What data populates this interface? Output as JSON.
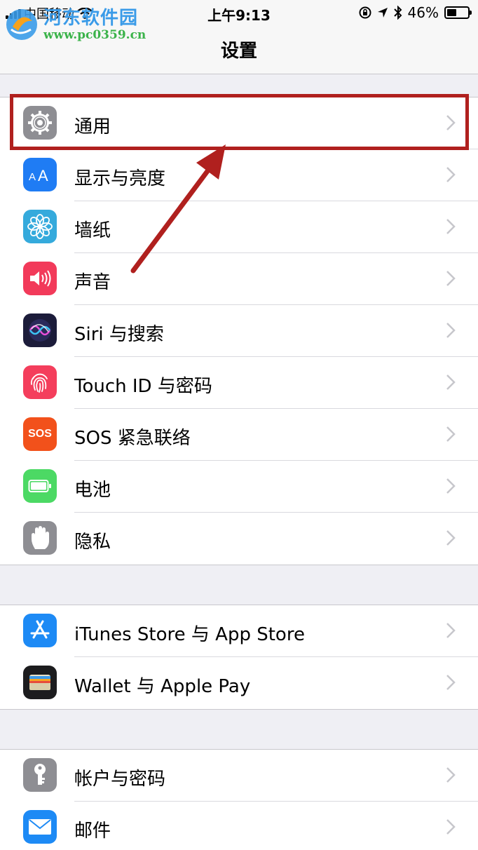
{
  "status_bar": {
    "carrier": "中国移动",
    "time": "上午9:13",
    "battery_percent": "46%",
    "battery_level": 0.46
  },
  "watermark": {
    "name": "河东软件园",
    "url": "www.pc0359.cn"
  },
  "nav": {
    "title": "设置"
  },
  "groups": [
    {
      "items": [
        {
          "label": "通用",
          "icon": "gear-icon",
          "color": "#8e8e93"
        },
        {
          "label": "显示与亮度",
          "icon": "text-size-icon",
          "color": "#1f7cf4"
        },
        {
          "label": "墙纸",
          "icon": "flower-icon",
          "color": "#35aadc"
        },
        {
          "label": "声音",
          "icon": "speaker-icon",
          "color": "#f23a5a"
        },
        {
          "label": "Siri 与搜索",
          "icon": "siri-icon",
          "color": "#1c1c3a"
        },
        {
          "label": "Touch ID 与密码",
          "icon": "fingerprint-icon",
          "color": "#f43e5c"
        },
        {
          "label": "SOS 紧急联络",
          "icon": "sos-icon",
          "color": "#f2511b"
        },
        {
          "label": "电池",
          "icon": "battery-icon",
          "color": "#4cd964"
        },
        {
          "label": "隐私",
          "icon": "hand-icon",
          "color": "#8e8e93"
        }
      ]
    },
    {
      "items": [
        {
          "label": "iTunes Store 与 App Store",
          "icon": "app-store-icon",
          "color": "#1d8af5"
        },
        {
          "label": "Wallet 与 Apple Pay",
          "icon": "wallet-icon",
          "color": "#1c1c1e"
        }
      ]
    },
    {
      "items": [
        {
          "label": "帐户与密码",
          "icon": "key-icon",
          "color": "#8e8e93"
        },
        {
          "label": "邮件",
          "icon": "mail-icon",
          "color": "#1d8af5"
        }
      ]
    }
  ],
  "sos_text": "SOS"
}
